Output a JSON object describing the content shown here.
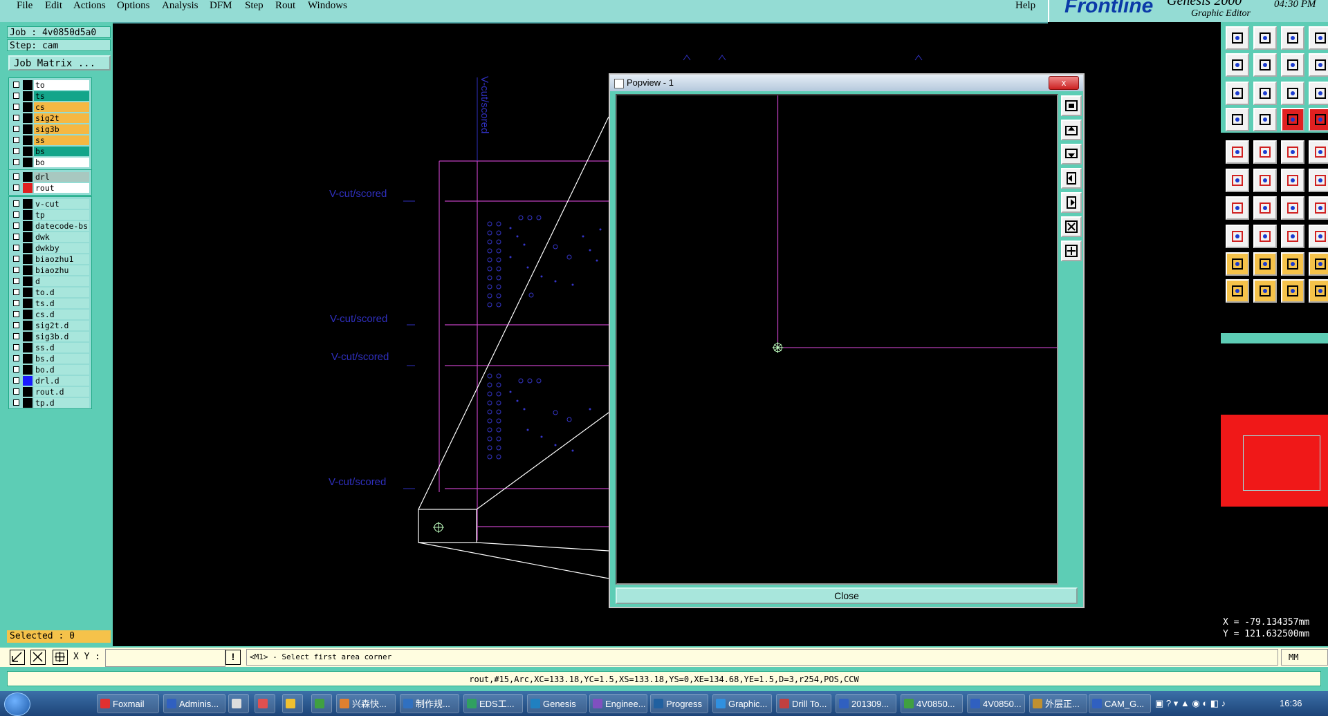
{
  "menu": {
    "items": [
      "File",
      "Edit",
      "Actions",
      "Options",
      "Analysis",
      "DFM",
      "Step",
      "Rout",
      "Windows"
    ],
    "help": "Help"
  },
  "brand": {
    "logo": "Frontline",
    "product": "Genesis 2000",
    "subtitle": "Graphic Editor",
    "clock": "04:30 PM"
  },
  "job": {
    "job_line": "Job : 4v0850d5a0",
    "step_line": "Step: cam",
    "matrix_button": "Job Matrix ..."
  },
  "layers_board": [
    {
      "name": "to",
      "color": "#ffffff",
      "sw": "#000000"
    },
    {
      "name": "ts",
      "color": "#13a58a",
      "sw": "#000000"
    },
    {
      "name": "cs",
      "color": "#f5b843",
      "sw": "#000000"
    },
    {
      "name": "sig2t",
      "color": "#f5b843",
      "sw": "#000000"
    },
    {
      "name": "sig3b",
      "color": "#f5b843",
      "sw": "#000000"
    },
    {
      "name": "ss",
      "color": "#f5b843",
      "sw": "#000000"
    },
    {
      "name": "bs",
      "color": "#13a58a",
      "sw": "#000000"
    },
    {
      "name": "bo",
      "color": "#ffffff",
      "sw": "#000000"
    }
  ],
  "layers_drill": [
    {
      "name": "drl",
      "color": "#a8c8c0",
      "sw": "#000000"
    },
    {
      "name": "rout",
      "color": "#ffffff",
      "sw": "#e02020"
    }
  ],
  "layers_misc": [
    {
      "name": "v-cut",
      "color": "#a8e6dc",
      "sw": "#000000"
    },
    {
      "name": "tp",
      "color": "#a8e6dc",
      "sw": "#000000"
    },
    {
      "name": "datecode-bs",
      "color": "#a8e6dc",
      "sw": "#000000"
    },
    {
      "name": "dwk",
      "color": "#a8e6dc",
      "sw": "#000000"
    },
    {
      "name": "dwkby",
      "color": "#a8e6dc",
      "sw": "#000000"
    },
    {
      "name": "biaozhu1",
      "color": "#a8e6dc",
      "sw": "#000000"
    },
    {
      "name": "biaozhu",
      "color": "#a8e6dc",
      "sw": "#000000"
    },
    {
      "name": "d",
      "color": "#a8e6dc",
      "sw": "#000000"
    },
    {
      "name": "to.d",
      "color": "#a8e6dc",
      "sw": "#000000"
    },
    {
      "name": "ts.d",
      "color": "#a8e6dc",
      "sw": "#000000"
    },
    {
      "name": "cs.d",
      "color": "#a8e6dc",
      "sw": "#000000"
    },
    {
      "name": "sig2t.d",
      "color": "#a8e6dc",
      "sw": "#000000"
    },
    {
      "name": "sig3b.d",
      "color": "#a8e6dc",
      "sw": "#000000"
    },
    {
      "name": "ss.d",
      "color": "#a8e6dc",
      "sw": "#000000"
    },
    {
      "name": "bs.d",
      "color": "#a8e6dc",
      "sw": "#000000"
    },
    {
      "name": "bo.d",
      "color": "#a8e6dc",
      "sw": "#000000"
    },
    {
      "name": "drl.d",
      "color": "#a8e6dc",
      "sw": "#1a1aff"
    },
    {
      "name": "rout.d",
      "color": "#a8e6dc",
      "sw": "#000000"
    },
    {
      "name": "tp.d",
      "color": "#a8e6dc",
      "sw": "#000000"
    }
  ],
  "selected": "Selected : 0",
  "canvas": {
    "vcut_label": "V-cut/scored",
    "vcut_vertical": "V-cut/scored"
  },
  "popview": {
    "title": "Popview - 1",
    "close_button": "Close",
    "x_button": "x"
  },
  "coords": {
    "x": "X = -79.134357mm",
    "y": "Y = 121.632500mm"
  },
  "command": {
    "xy_label": "X Y :",
    "xy_value": "",
    "exclaim": "!",
    "prompt": "<M1> - Select first area corner",
    "units": "MM"
  },
  "status": "rout,#15,Arc,XC=133.18,YC=1.5,XS=133.18,YS=0,XE=134.68,YE=1.5,D=3,r254,POS,CCW",
  "taskbar": {
    "items": [
      "Foxmail",
      "Adminis...",
      "",
      "",
      "",
      "",
      "兴森快...",
      "制作规...",
      "EDS工...",
      "Genesis",
      "Enginee...",
      "Progress",
      "Graphic...",
      "Drill To...",
      "201309...",
      "4V0850...",
      "4V0850...",
      "外层正...",
      "CAM_G..."
    ],
    "time": "16:36"
  }
}
